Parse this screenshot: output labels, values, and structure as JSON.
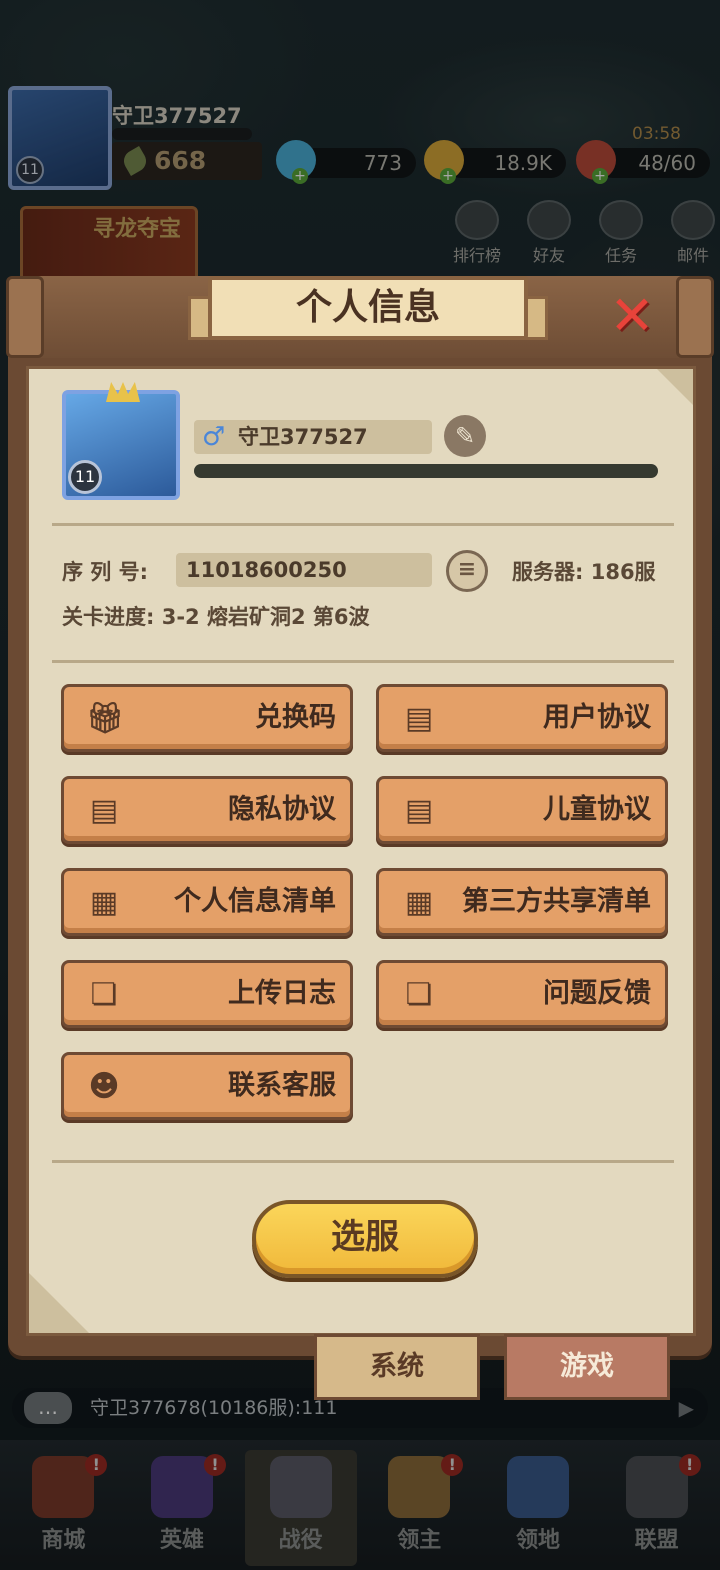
{
  "hud": {
    "player_name": "守卫377527",
    "level": "11",
    "power": "668",
    "gems": "773",
    "gold": "18.9K",
    "stamina": "48/60",
    "timer": "03:58",
    "tools": [
      {
        "label": "排行榜",
        "icon": "ranking-icon"
      },
      {
        "label": "好友",
        "icon": "friends-icon"
      },
      {
        "label": "任务",
        "icon": "quest-icon"
      },
      {
        "label": "邮件",
        "icon": "mail-icon"
      }
    ],
    "event_banner": "寻龙夺宝"
  },
  "panel": {
    "title": "个人信息",
    "close_icon": "close-icon",
    "profile": {
      "level": "11",
      "name": "守卫377527",
      "gender_icon": "male-icon"
    },
    "serial_label": "序 列 号:",
    "serial_value": "11018600250",
    "server_label": "服务器:",
    "server_value": "186服",
    "progress_label": "关卡进度:",
    "progress_value": "3-2 熔岩矿洞2 第6波",
    "buttons": [
      {
        "label": "兑换码",
        "icon": "gift-icon"
      },
      {
        "label": "用户协议",
        "icon": "user-doc-icon"
      },
      {
        "label": "隐私协议",
        "icon": "privacy-doc-icon"
      },
      {
        "label": "儿童协议",
        "icon": "child-doc-icon"
      },
      {
        "label": "个人信息清单",
        "icon": "clipboard-icon"
      },
      {
        "label": "第三方共享清单",
        "icon": "clipboard-icon"
      },
      {
        "label": "上传日志",
        "icon": "chat-bubble-icon"
      },
      {
        "label": "问题反馈",
        "icon": "chat-bubble-icon"
      },
      {
        "label": "联系客服",
        "icon": "support-agent-icon"
      }
    ],
    "select_server": "选服",
    "tabs": {
      "system": "系统",
      "game": "游戏"
    }
  },
  "chat": {
    "message": "守卫377678(10186服):111"
  },
  "bottom_nav": [
    {
      "label": "商城",
      "alert": "!"
    },
    {
      "label": "英雄",
      "alert": "!"
    },
    {
      "label": "战役",
      "alert": ""
    },
    {
      "label": "领主",
      "alert": "!"
    },
    {
      "label": "领地",
      "alert": ""
    },
    {
      "label": "联盟",
      "alert": "!"
    }
  ],
  "colors": {
    "panel_wood": "#6b4a33",
    "paper": "#e3d9bf",
    "button": "#e4a068",
    "select_button": "#f0b83a",
    "close": "#e8433a"
  }
}
